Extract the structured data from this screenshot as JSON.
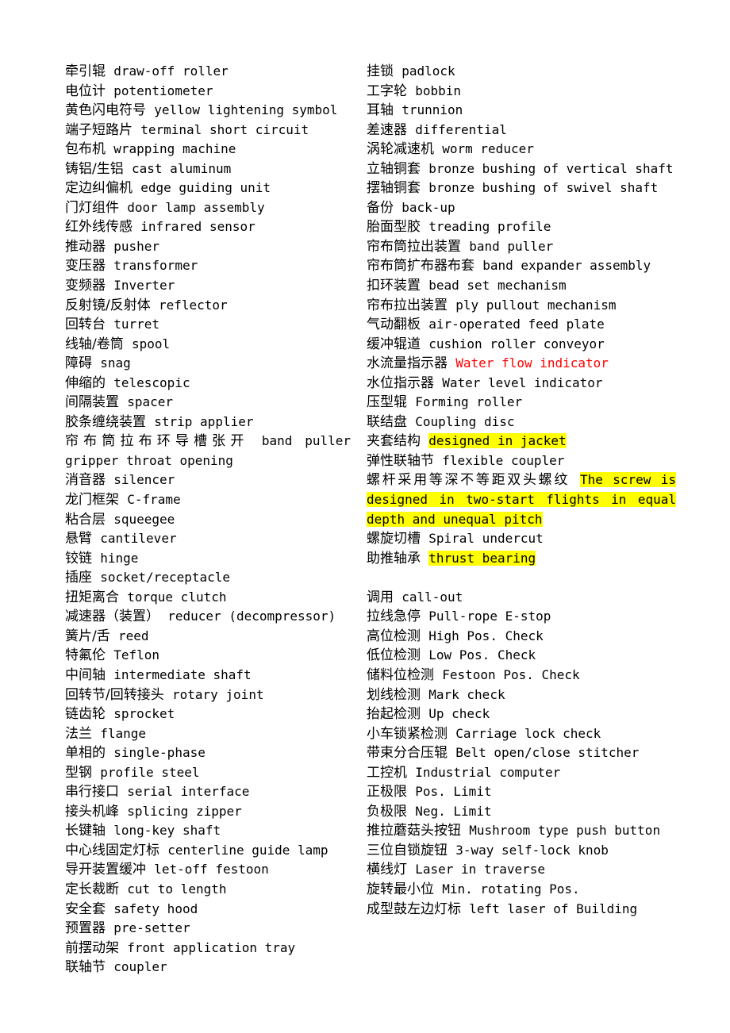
{
  "document": {
    "type": "bilingual-glossary",
    "page_background": "#ffffff",
    "text_color": "#000000",
    "highlight_color": "#ffff00",
    "accent_color": "#ff0000",
    "columns": 2
  },
  "left_column": {
    "entries": [
      {
        "cn": "牵引辊",
        "en": "draw-off roller"
      },
      {
        "cn": "电位计",
        "en": "potentiometer"
      },
      {
        "cn": "黄色闪电符号",
        "en": "yellow lightening symbol"
      },
      {
        "cn": "端子短路片",
        "en": "terminal short circuit"
      },
      {
        "cn": "包布机",
        "en": "wrapping machine"
      },
      {
        "cn": "铸铝/生铝",
        "en": "cast aluminum"
      },
      {
        "cn": "定边纠偏机",
        "en": "edge guiding unit"
      },
      {
        "cn": "门灯组件",
        "en": "door lamp assembly"
      },
      {
        "cn": "红外线传感",
        "en": "infrared sensor"
      },
      {
        "cn": "推动器",
        "en": "pusher"
      },
      {
        "cn": "变压器",
        "en": "transformer"
      },
      {
        "cn": "变频器",
        "en": "Inverter"
      },
      {
        "cn": "反射镜/反射体",
        "en": "reflector"
      },
      {
        "cn": "回转台",
        "en": "turret"
      },
      {
        "cn": "线轴/卷筒",
        "en": "spool"
      },
      {
        "cn": "障碍",
        "en": "snag"
      },
      {
        "cn": "伸缩的",
        "en": "telescopic"
      },
      {
        "cn": "间隔装置",
        "en": "spacer"
      },
      {
        "cn": "胶条缠绕装置",
        "en": "strip applier"
      },
      {
        "cn": "帘布筒拉布环导槽张开",
        "en": "band puller gripper throat opening",
        "wraps": true
      },
      {
        "cn": "消音器",
        "en": "silencer"
      },
      {
        "cn": "龙门框架",
        "en": "C-frame"
      },
      {
        "cn": "粘合层",
        "en": "squeegee"
      },
      {
        "cn": "悬臂",
        "en": "cantilever"
      },
      {
        "cn": "铰链",
        "en": "hinge"
      },
      {
        "cn": "插座",
        "en": "socket/receptacle"
      },
      {
        "cn": "扭矩离合",
        "en": "torque clutch"
      },
      {
        "cn": "减速器（装置）",
        "en": "reducer (decompressor)"
      },
      {
        "cn": "簧片/舌",
        "en": "reed"
      },
      {
        "cn": "特氟伦",
        "en": "Teflon"
      },
      {
        "cn": "中间轴",
        "en": "intermediate shaft"
      },
      {
        "cn": "回转节/回转接头",
        "en": "rotary joint"
      },
      {
        "cn": "链齿轮",
        "en": "sprocket"
      },
      {
        "cn": "法兰",
        "en": "flange"
      },
      {
        "cn": "单相的",
        "en": "single-phase"
      },
      {
        "cn": "型钢",
        "en": "profile steel"
      },
      {
        "cn": "串行接口",
        "en": "serial interface"
      },
      {
        "cn": "接头机峰",
        "en": "splicing zipper"
      },
      {
        "cn": "长键轴",
        "en": "long-key shaft"
      },
      {
        "cn": "中心线固定灯标",
        "en": "centerline guide lamp"
      },
      {
        "cn": "导开装置缓冲",
        "en": "let-off festoon"
      },
      {
        "cn": "定长裁断",
        "en": "cut to length"
      },
      {
        "cn": "安全套",
        "en": "safety hood"
      },
      {
        "cn": "预置器",
        "en": "pre-setter"
      },
      {
        "cn": "前摆动架",
        "en": "front application tray"
      },
      {
        "cn": "联轴节",
        "en": "coupler"
      }
    ]
  },
  "right_column": {
    "entries": [
      {
        "cn": "挂锁",
        "en": "padlock"
      },
      {
        "cn": "工字轮",
        "en": "bobbin"
      },
      {
        "cn": "耳轴",
        "en": "trunnion"
      },
      {
        "cn": "差速器",
        "en": "differential"
      },
      {
        "cn": "涡轮减速机",
        "en": "worm reducer"
      },
      {
        "cn": "立轴铜套",
        "en": "bronze bushing of vertical shaft",
        "wraps": true
      },
      {
        "cn": "摆轴铜套",
        "en": "bronze bushing of swivel shaft"
      },
      {
        "cn": "备份",
        "en": "back-up"
      },
      {
        "cn": "胎面型胶",
        "en": "treading profile"
      },
      {
        "cn": "帘布筒拉出装置",
        "en": "band puller"
      },
      {
        "cn": "帘布筒扩布器布套",
        "en": "band expander assembly",
        "wraps": true
      },
      {
        "cn": "扣环装置",
        "en": "bead set mechanism"
      },
      {
        "cn": "帘布拉出装置",
        "en": "ply pullout mechanism"
      },
      {
        "cn": "气动翻板",
        "en": "air-operated feed plate"
      },
      {
        "cn": "缓冲辊道",
        "en": "cushion roller conveyor"
      },
      {
        "cn": "水流量指示器",
        "en": "Water flow indicator",
        "style": "red"
      },
      {
        "cn": "水位指示器",
        "en": "Water level indicator"
      },
      {
        "cn": "压型辊",
        "en": "Forming roller"
      },
      {
        "cn": "联结盘",
        "en": "Coupling disc"
      },
      {
        "cn": "夹套结构",
        "en": "designed in jacket",
        "style": "highlight"
      },
      {
        "cn": "弹性联轴节",
        "en": "flexible coupler"
      },
      {
        "cn": "螺杆采用等深不等距双头螺纹",
        "en": "The screw is designed in two-start flights in equal depth and unequal pitch",
        "style": "highlight",
        "wraps": true
      },
      {
        "cn": "螺旋切槽",
        "en": "Spiral undercut"
      },
      {
        "cn": "助推轴承",
        "en": "thrust bearing",
        "style": "highlight"
      },
      {
        "cn": "",
        "en": "",
        "blank": true
      },
      {
        "cn": "调用",
        "en": "call-out"
      },
      {
        "cn": "拉线急停",
        "en": "Pull-rope E-stop"
      },
      {
        "cn": "高位检测",
        "en": "High Pos. Check"
      },
      {
        "cn": "低位检测",
        "en": "Low Pos. Check"
      },
      {
        "cn": "储料位检测",
        "en": "Festoon Pos. Check"
      },
      {
        "cn": "划线检测",
        "en": "Mark check"
      },
      {
        "cn": "抬起检测",
        "en": "Up check"
      },
      {
        "cn": "小车锁紧检测",
        "en": "Carriage lock check"
      },
      {
        "cn": "带束分合压辊",
        "en": "Belt open/close stitcher"
      },
      {
        "cn": "工控机",
        "en": "Industrial computer"
      },
      {
        "cn": "正极限",
        "en": "Pos. Limit"
      },
      {
        "cn": "负极限",
        "en": "Neg. Limit"
      },
      {
        "cn": "推拉蘑菇头按钮",
        "en": "Mushroom type push button",
        "wraps": true
      },
      {
        "cn": "三位自锁旋钮",
        "en": "3-way self-lock  knob"
      },
      {
        "cn": "横线灯",
        "en": "Laser in traverse"
      },
      {
        "cn": "旋转最小位",
        "en": "Min. rotating Pos."
      },
      {
        "cn": "成型鼓左边灯标",
        "en": "left laser of Building"
      }
    ]
  }
}
